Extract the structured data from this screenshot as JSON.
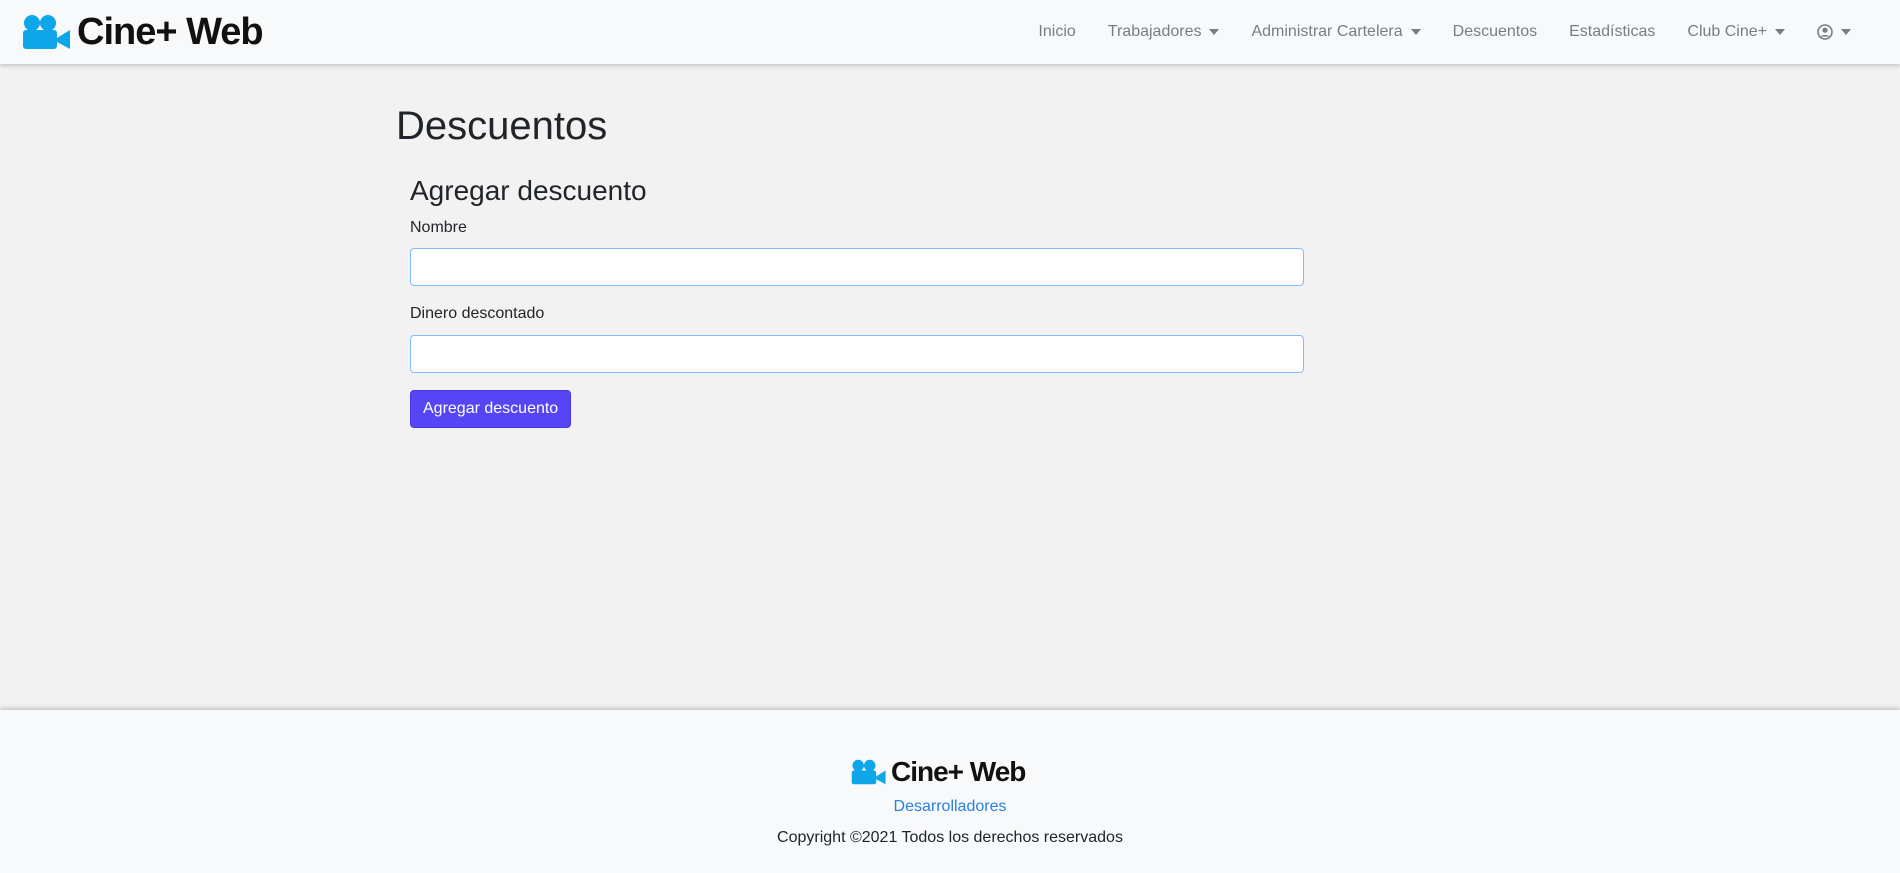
{
  "brand": {
    "name": "Cine+ Web",
    "icon": "video-camera-icon",
    "color": "#0ea5e9"
  },
  "nav": {
    "items": [
      {
        "label": "Inicio",
        "dropdown": false
      },
      {
        "label": "Trabajadores",
        "dropdown": true
      },
      {
        "label": "Administrar Cartelera",
        "dropdown": true
      },
      {
        "label": "Descuentos",
        "dropdown": false
      },
      {
        "label": "Estadísticas",
        "dropdown": false
      },
      {
        "label": "Club Cine+",
        "dropdown": true
      }
    ],
    "user_icon": "user-circle-icon"
  },
  "page": {
    "title": "Descuentos"
  },
  "form": {
    "heading": "Agregar descuento",
    "name_label": "Nombre",
    "name_value": "",
    "amount_label": "Dinero descontado",
    "amount_value": "",
    "submit_label": "Agregar descuento",
    "accent": "#5545f5"
  },
  "footer": {
    "brand_name": "Cine+ Web",
    "developers_link": "Desarrolladores",
    "copyright": "Copyright ©2021 Todos los derechos reservados"
  }
}
